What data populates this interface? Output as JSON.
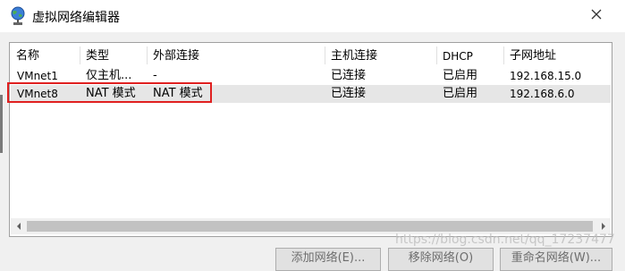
{
  "window": {
    "title": "虚拟网络编辑器"
  },
  "table": {
    "columns": [
      "名称",
      "类型",
      "外部连接",
      "主机连接",
      "DHCP",
      "子网地址"
    ],
    "rows": [
      {
        "name": "VMnet1",
        "type": "仅主机...",
        "external": "-",
        "host": "已连接",
        "dhcp": "已启用",
        "subnet": "192.168.15.0"
      },
      {
        "name": "VMnet8",
        "type": "NAT 模式",
        "external": "NAT 模式",
        "host": "已连接",
        "dhcp": "已启用",
        "subnet": "192.168.6.0"
      }
    ],
    "selected_row": 1
  },
  "buttons": {
    "add_network": "添加网络(E)...",
    "remove_network": "移除网络(O)",
    "rename_network": "重命名网络(W)..."
  },
  "watermark": "https://blog.csdn.net/qq_17237477",
  "colors": {
    "highlight_border": "#e02020",
    "selected_row": "#e6e6e6"
  },
  "icons": {
    "app": "network-globe-icon",
    "close": "close-icon"
  }
}
